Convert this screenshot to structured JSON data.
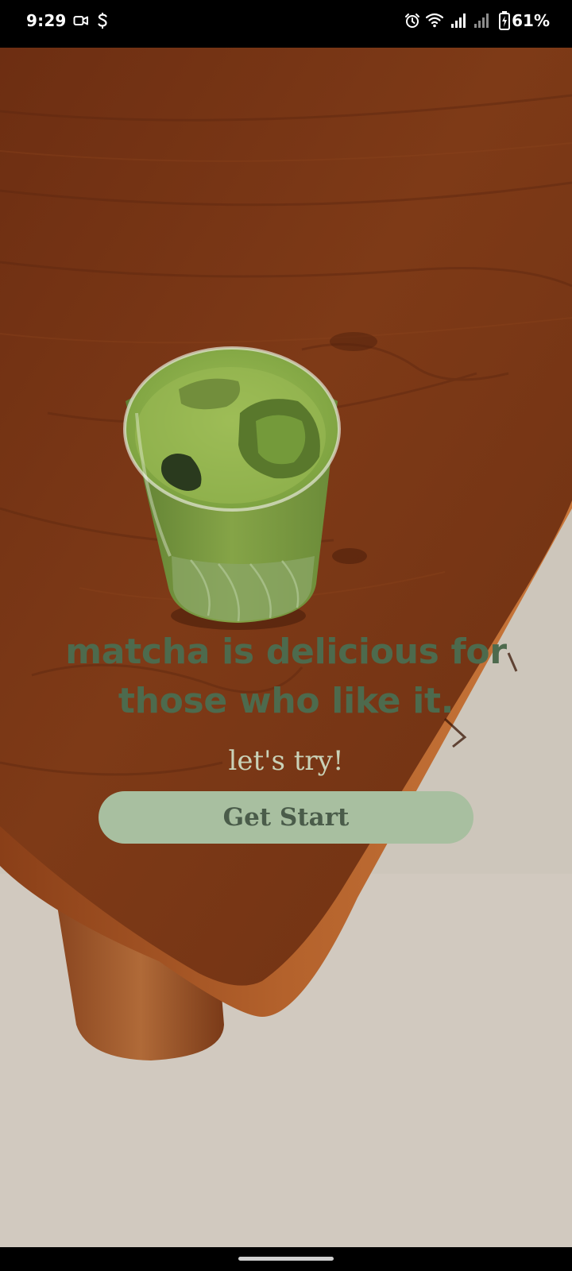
{
  "status_bar": {
    "time": "9:29",
    "battery_percent": "61%",
    "left_icons": [
      "video-camera-icon",
      "sync-s-icon"
    ],
    "right_icons": [
      "alarm-icon",
      "wifi-icon",
      "signal-icon",
      "signal-secondary-icon",
      "battery-charging-icon"
    ]
  },
  "hero": {
    "image": "iced-matcha-glass-on-wooden-table",
    "headline": "matcha is delicious for those who like it.",
    "subline": "let's try!",
    "cta_label": "Get Start"
  },
  "colors": {
    "headline": "#4d6a4d",
    "subline": "#c9d2b8",
    "cta_background": "#a8bfa0",
    "cta_text": "#4a5c4a",
    "table_wood": "#7a3716",
    "floor": "#cfc8bd"
  }
}
